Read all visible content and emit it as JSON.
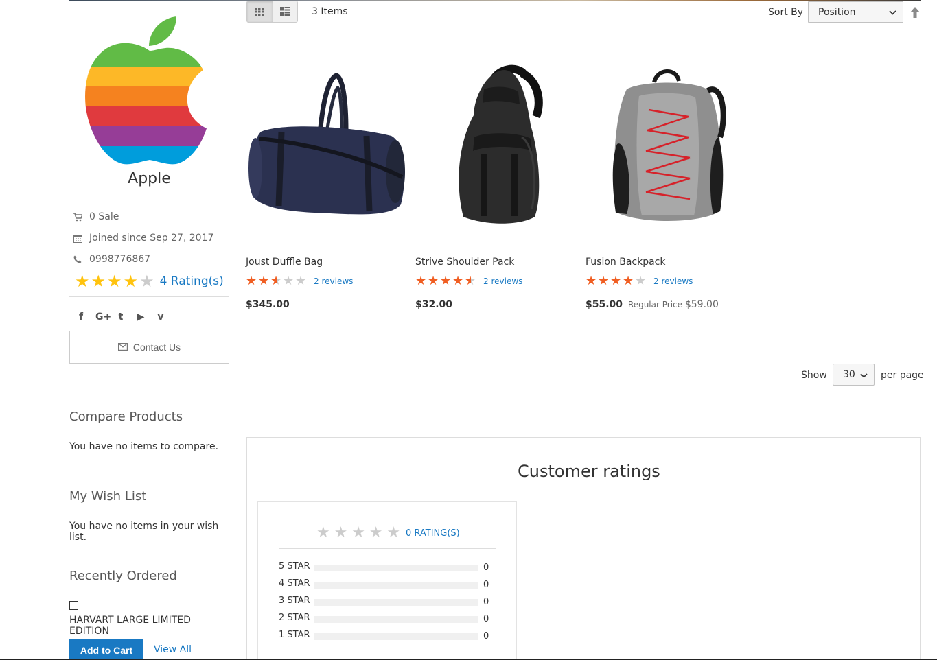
{
  "vendor": {
    "name": "Apple",
    "sales": "0 Sale",
    "joined": "Joined since Sep 27, 2017",
    "phone": "0998776867",
    "rating_value": 4,
    "rating_max": 5,
    "ratings_label": "4 Rating(s)",
    "social_icons": [
      "facebook-icon",
      "google-plus-icon",
      "twitter-icon",
      "youtube-icon",
      "vimeo-icon"
    ],
    "social_glyphs": [
      "f",
      "G+",
      "t",
      "▶",
      "v"
    ],
    "contact_label": "Contact Us"
  },
  "sidebar": {
    "compare_title": "Compare Products",
    "compare_text": "You have no items to compare.",
    "wishlist_title": "My Wish List",
    "wishlist_text": "You have no items in your wish list.",
    "recent_title": "Recently Ordered",
    "recent_item": "HARVART LARGE LIMITED EDITION",
    "add_to_cart": "Add to Cart",
    "view_all": "View All"
  },
  "toolbar": {
    "items_count": "3 Items",
    "sort_label": "Sort By",
    "sort_value": "Position",
    "show_label": "Show",
    "limit_value": "30",
    "per_page": "per page"
  },
  "products": [
    {
      "name": "Joust Duffle Bag",
      "rating": 2.5,
      "reviews": "2 reviews",
      "price": "$345.00",
      "regular_label": "",
      "regular_price": ""
    },
    {
      "name": "Strive Shoulder Pack",
      "rating": 4.5,
      "reviews": "2 reviews",
      "price": "$32.00",
      "regular_label": "",
      "regular_price": ""
    },
    {
      "name": "Fusion Backpack",
      "rating": 4,
      "reviews": "2 reviews",
      "price": "$55.00",
      "regular_label": "Regular Price",
      "regular_price": "$59.00"
    }
  ],
  "customer_ratings": {
    "title": "Customer ratings",
    "summary_link": "0 RATING(S)",
    "rows": [
      {
        "label": "5 STAR",
        "count": "0"
      },
      {
        "label": "4 STAR",
        "count": "0"
      },
      {
        "label": "3 STAR",
        "count": "0"
      },
      {
        "label": "2 STAR",
        "count": "0"
      },
      {
        "label": "1 STAR",
        "count": "0"
      }
    ]
  },
  "colors": {
    "link": "#1979c3",
    "vendor_star": "#ffc30e",
    "product_star": "#f05e22",
    "empty_star": "#cccccc"
  }
}
